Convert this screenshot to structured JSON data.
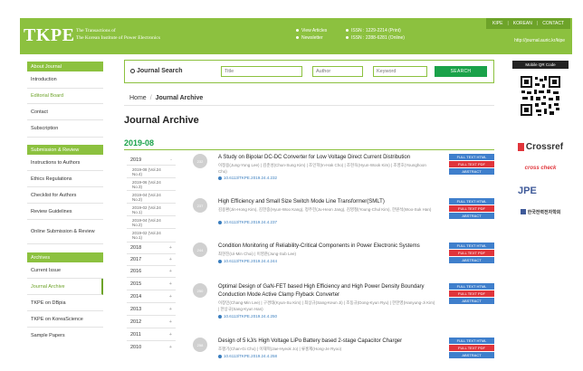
{
  "header": {
    "logo": "TKPE",
    "subtitle_line1": "The Transactions of",
    "subtitle_line2": "The Korean Institute of Power Electronics",
    "info": [
      {
        "label": "View Articles",
        "value": "ISSN : 1229-2214 (Print)"
      },
      {
        "label": "Newsletter",
        "value": "ISSN : 2288-6281 (Online)"
      }
    ],
    "top_links": [
      "KIPE",
      "KOREAN",
      "CONTACT"
    ],
    "url": "http://journal.auric.kr/kipe"
  },
  "sidebar": {
    "sections": [
      {
        "title": "About Journal",
        "items": [
          "Introduction",
          "Editorial Board",
          "Contact",
          "Subscription"
        ]
      },
      {
        "title": "Submission & Review",
        "items": [
          "Instructions to Authors",
          "Ethics Regulations",
          "Checklist for Authors",
          "Review Guidelines",
          "Online Submission & Review"
        ]
      },
      {
        "title": "Archives",
        "items": [
          "Current Issue",
          "Journal Archive",
          "TKPE on DBpia",
          "TKPE on KoreaScience",
          "Sample Papers"
        ]
      }
    ]
  },
  "search": {
    "label": "Journal Search",
    "title_placeholder": "Title",
    "author_placeholder": "Author",
    "keyword_placeholder": "Keyword",
    "button": "SEARCH"
  },
  "breadcrumb": {
    "home": "Home",
    "current": "Journal Archive"
  },
  "page_title": "Journal Archive",
  "issue_date": "2019-08",
  "years": {
    "current_year": "2019",
    "current_issues": [
      "2019-08 (Vol.24 No.4)",
      "2019-06 (Vol.24 No.3)",
      "2019-04 (Vol.24 No.2)",
      "2019-02 (Vol.24 No.1)",
      "2019-04 (Vol.24 No.2)",
      "2019-02 (Vol.24 No.1)"
    ],
    "other_years": [
      "2018",
      "2017",
      "2016",
      "2015",
      "2014",
      "2013",
      "2012",
      "2011",
      "2010"
    ]
  },
  "buttons": {
    "html": "FULL TEXT HTML",
    "pdf": "FULL TEXT PDF",
    "abstract": "ABSTRACT"
  },
  "articles": [
    {
      "page": "232",
      "title": "A Study on Bipolar DC-DC Converter for Low Voltage Direct Current Distribution",
      "authors": "이정용(Jung-Yong Lee) | 김춘성(Chun-Sung Kim) | 조인학(In-Hak Cho) | 조현욱(Hyun-Wook Kim) | 조영호(Younghoon Cho)",
      "doi": "10.6113/TKPE.2019.24.4.232"
    },
    {
      "page": "237",
      "title": "High Efficiency and Small Size Switch Mode Line Transformer(SMLT)",
      "authors": "김용환(Jin-Hong Kim), 김헌중(Hyun-Woo Kang), 정주헌(Ju-Heon Jang), 김영철(Young-Chul Kim), 한원석(Woo-Suk Han)",
      "doi": "10.6113/TKPE.2019.24.4.237"
    },
    {
      "page": "244",
      "title": "Condition Monitoring of Reliability-Critical Components in Power Electronic Systems",
      "authors": "최현진(Ui-Min Choi) | 이영준(Jung-Sub Lee)",
      "doi": "10.6113/TKPE.2019.24.4.244"
    },
    {
      "page": "250",
      "title": "Optimal Design of GaN-FET based High Efficiency and High Power Density Boundary Conduction Mode Active Clamp Flyback Converter",
      "authors": "이창민(Chang-Min Lee) | 구경태(Kyun-Su Kim) | 최상규(Sang-Keun Ji) | 조동규(Dong-Kyun Ryu) | 한한영(Hanyung-Ji Kim) | 한상규(Sang-Kyun Han)",
      "doi": "10.6113/TKPE.2019.24.4.250"
    },
    {
      "page": "258",
      "title": "Design of 5 kJ/s High Voltage LiPo Battery based 2-stage Capacitor Charger",
      "authors": "조평기(Chan-Gi Cho) | 이재혁(Jae-Hyeok Jo) | 류홍제(Hong-Je Ryoo)",
      "doi": "10.6113/TKPE.2019.24.4.258"
    }
  ],
  "right": {
    "qr_title": "Mobile QR Code",
    "partners": [
      "Crossref",
      "cross check",
      "JPE",
      "한국전력전자학회"
    ]
  },
  "colors": {
    "brand": "#8cc13f",
    "accent": "#1aa24a",
    "pdf": "#e0353b",
    "html": "#3f7fcc"
  }
}
